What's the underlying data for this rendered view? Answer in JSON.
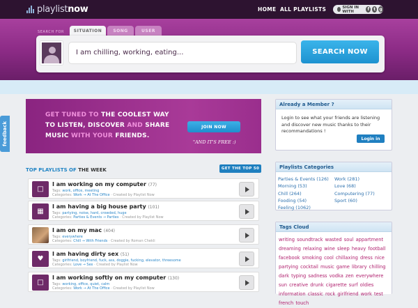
{
  "header": {
    "logo_bold": "playlist",
    "logo_light": "now",
    "nav": [
      "HOME",
      "ALL PLAYLISTS"
    ],
    "signin_label": "SIGN IN WITH",
    "social": [
      "f",
      "t",
      "g"
    ]
  },
  "search": {
    "for_label": "SEARCH FOR",
    "tabs": [
      "SITUATION",
      "SONG",
      "USER"
    ],
    "query": "I am chilling, working, eating...",
    "button": "SEARCH NOW"
  },
  "feedback_label": "feedback",
  "banner": {
    "line1_a": "GET TUNED TO ",
    "line1_b": "THE COOLEST WAY",
    "line2_a": "TO LISTEN, DISCOVER ",
    "line2_b": "AND ",
    "line2_c": "SHARE",
    "line3_a": "MUSIC ",
    "line3_b": "WITH YOUR ",
    "line3_c": "FRIENDS.",
    "join": "JOIN NOW",
    "free": "\"AND IT'S FREE :)"
  },
  "top": {
    "title_a": "TOP PLAYLISTS OF ",
    "title_b": "THE WEEK",
    "button": "GET THE TOP 50",
    "items": [
      {
        "title": "I am working on my computer",
        "count": "(77)",
        "tags_label": "Tags:",
        "tags": "work, office, meeting",
        "cat_label": "Categories:",
        "cats": "Work → At The Office",
        "by": "· Created by Playlist Now",
        "icon": "monitor"
      },
      {
        "title": "I am having a big house party",
        "count": "(101)",
        "tags_label": "Tags:",
        "tags": "partying, noise, hard, crowded, huge",
        "cat_label": "Categories:",
        "cats": "Parties & Events → Parties",
        "by": "· Created by Playlist Now",
        "icon": "trash"
      },
      {
        "title": "I am on my mac",
        "count": "(404)",
        "tags_label": "Tags:",
        "tags": "everywhere",
        "cat_label": "Categories:",
        "cats": "Chill → With Friends",
        "by": "· Created by Roman Chekli",
        "icon": "photo"
      },
      {
        "title": "I am having dirty sex",
        "count": "(51)",
        "tags_label": "Tags:",
        "tags": "girlfriend, boyfriend, fuck, ass, doggie, fucking, elevator, threesome",
        "cat_label": "Categories:",
        "cats": "Love → Sex",
        "by": "· Created by Playlist Now",
        "icon": "heart"
      },
      {
        "title": "I am working softly on my computer",
        "count": "(130)",
        "tags_label": "Tags:",
        "tags": "working, office, quiet, calm",
        "cat_label": "Categories:",
        "cats": "Work → At The Office",
        "by": "· Created by Playlist Now",
        "icon": "monitor"
      }
    ]
  },
  "member": {
    "title": "Already a Member ?",
    "text": "Login to see what your friends are listening and discover new music thanks to their recommandations !",
    "button": "Login in"
  },
  "categories": {
    "title": "Playlists Categories",
    "left": [
      "Parties & Events (126)",
      "Morning (53)",
      "Chill (264)",
      "Fooding (54)",
      "Feeling (1062)"
    ],
    "right": [
      "Work (281)",
      "Love (68)",
      "Computering (77)",
      "Sport (60)"
    ]
  },
  "tags": {
    "title": "Tags Cloud",
    "cloud": "writing soundtrack wasted soul appartment dreaming relaxing wine sleep heavy football facebook smoking cool chillaxing dress nice partying cocktail music game library chilling dark typing sadness vodka zen everywhere sun creative drunk cigarette surf oldies information classic rock girlfriend work test french touch"
  }
}
